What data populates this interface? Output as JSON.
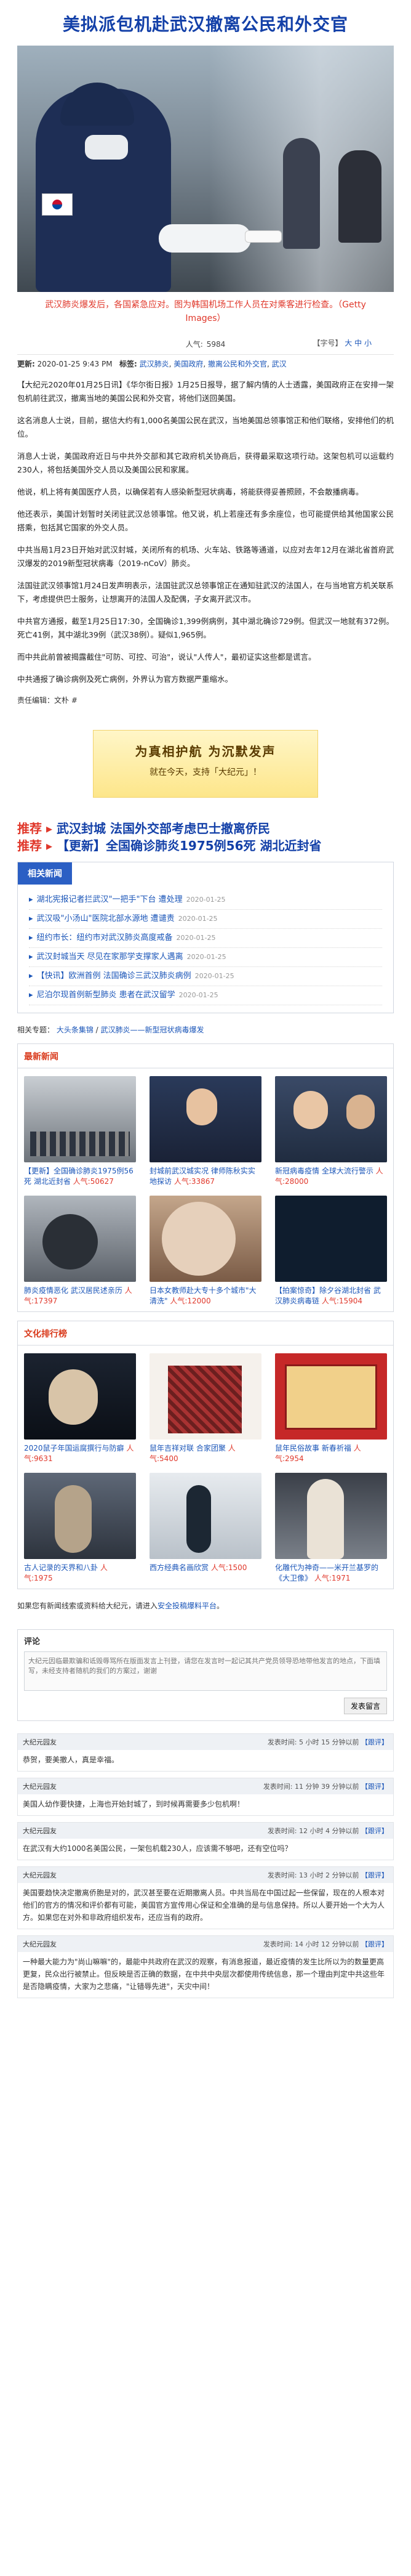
{
  "headline": "美拟派包机赴武汉撤离公民和外交官",
  "hero_caption": "武汉肺炎爆发后，各国紧急应对。图为韩国机场工作人员在对乘客进行检查。（Getty Images）",
  "toolbar": {
    "views_label": "人气:",
    "views": "5984",
    "font_label": "【字号】",
    "font_large": "大",
    "font_mid": "中",
    "font_small": "小"
  },
  "meta": {
    "updated_label": "更新:",
    "updated": "2020-01-25 9:43 PM",
    "tags_label": "标签:",
    "tags": [
      "武汉肺炎",
      "美国政府",
      "撤离公民和外交官",
      "武汉"
    ]
  },
  "paragraphs": [
    "【大纪元2020年01月25日讯】《华尔街日报》1月25日报导，据了解内情的人士透露，美国政府正在安排一架包机前往武汉，撤离当地的美国公民和外交官，将他们送回美国。",
    "这名消息人士说，目前，据信大约有1,000名美国公民在武汉，当地美国总领事馆正和他们联络，安排他们的机位。",
    "消息人士说，美国政府近日与中共外交部和其它政府机关协商后，获得最采取这项行动。这架包机可以运载约230人，将包括美国外交人员以及美国公民和家属。",
    "他说，机上将有美国医疗人员，以确保若有人感染新型冠状病毒，将能获得妥善照顾，不会散播病毒。",
    "他还表示，美国计划暂时关闭驻武汉总领事馆。他又说，机上若座还有多余座位，也可能提供给其他国家公民搭乘，包括其它国家的外交人员。",
    "中共当局1月23日开始对武汉封城，关闭所有的机场、火车站、铁路等通道，以应对去年12月在湖北省首府武汉爆发的2019新型冠状病毒（2019-nCoV）肺炎。",
    "法国驻武汉领事馆1月24日发声明表示，法国驻武汉总领事馆正在通知驻武汉的法国人，在与当地官方机关联系下，考虑提供巴士服务，让想离开的法国人及配偶，子女离开武汉市。",
    "中共官方通报，截至1月25日17:30，全国确诊1,399例病例，其中湖北确诊729例。但武汉一地就有372例。死亡41例，其中湖北39例（武汉38例）。疑似1,965例。",
    "而中共此前曾被揭露截住\"可防、可控、可治\"，说认\"人传人\"，最初证实这些都是谎言。",
    "中共通报了确诊病例及死亡病例，外界认为官方数据严重缩水。"
  ],
  "editor": "责任编辑：文朴 #",
  "ad": {
    "line1": "为真相护航 为沉默发声",
    "line2": "就在今天，支持「大纪元」！"
  },
  "push": [
    {
      "prefix": "推荐 ▸",
      "text": "武汉封城 法国外交部考虑巴士撤离侨民"
    },
    {
      "prefix": "推荐 ▸",
      "text": "【更新】全国确诊肺炎1975例56死 湖北近封省"
    }
  ],
  "related": {
    "title": "相关新闻",
    "items": [
      {
        "text": "湖北宪报记者拦武汉\"一把手\"下台 遭处理",
        "date": "2020-01-25"
      },
      {
        "text": "武汉吸\"小汤山\"医院北部水源地 遭谴责",
        "date": "2020-01-25"
      },
      {
        "text": "纽约市长：纽约市对武汉肺炎高度戒备",
        "date": "2020-01-25"
      },
      {
        "text": "武汉封城当天 尽见在家那学支撑家人遇离",
        "date": "2020-01-25"
      },
      {
        "text": "【快讯】欧洲首例 法国确诊三武汉肺炎病例",
        "date": "2020-01-25"
      },
      {
        "text": "尼泊尔现首例新型肺炎 患者在武汉留学",
        "date": "2020-01-25"
      }
    ]
  },
  "tags_line": {
    "label": "相关专题",
    "links": [
      "大头条集锦",
      "武汉肺炎——新型冠状病毒爆发"
    ]
  },
  "latest": {
    "title": "最新新闻",
    "views_label": "人气:",
    "cards": [
      {
        "title": "【更新】全国确诊肺炎1975例56死 湖北近封省",
        "views": "50627"
      },
      {
        "title": "封城前武汉城实况 律师陈秋实实地探访",
        "views": "33867"
      },
      {
        "title": "新冠病毒疫情 全球大流行警示",
        "views": "28000"
      },
      {
        "title": "肺炎疫情恶化 武汉居民述亲历",
        "views": "17397"
      },
      {
        "title": "日本女教师赴大专十多个城市\"大清洗\"",
        "views": "12000"
      },
      {
        "title": "【拍案惊奇】除夕谷湖北封省 武汉肺炎病毒链",
        "views": "15904"
      }
    ]
  },
  "culture": {
    "title": "文化排行榜",
    "views_label": "人气:",
    "cards": [
      {
        "title": "2020鼠子年国运腐撰行与防癖",
        "views": "9631"
      },
      {
        "title": "鼠年吉祥对联 合家团聚",
        "views": "5400"
      },
      {
        "title": "鼠年民俗故事 新春祈福",
        "views": "2954"
      },
      {
        "title": "古人记录的天界和八卦",
        "views": "1975"
      },
      {
        "title": "西方经典名画欣赏",
        "views": "1500"
      },
      {
        "title": "化雕代为神奇——米开兰基罗的《大卫像》",
        "views": "1971"
      }
    ]
  },
  "note": {
    "text": "如果您有新闻线索或资料给大纪元，请进入",
    "link": "安全投稿爆料平台",
    "tail": "。"
  },
  "comment_form": {
    "title": "评论",
    "placeholder": "大纪元因临最欺骗和诋毁辱骂所在版面发言上刊登，请您在发言时一起记其共产党员领导恐地带他发言的地点，下面填写，未经支持者随机的我们的方案过，谢谢",
    "hint": "",
    "submit": "发表留言"
  },
  "comments": [
    {
      "user": "大纪元园友",
      "time": "发表时间: 5 小时 15 分钟以前",
      "reply": "【跟评】",
      "text": "恭贺，要美撤人，真是幸福。"
    },
    {
      "user": "大纪元园友",
      "time": "发表时间: 11 分钟 39 分钟以前",
      "reply": "【跟评】",
      "text": "美国人幼作要快捷，上海也开始封城了，到时候再需要多少包机啊！"
    },
    {
      "user": "大纪元园友",
      "time": "发表时间: 12 小时 4 分钟以前",
      "reply": "【跟评】",
      "text": "在武汉有大约1000名美国公民，一架包机载230人，应该需不够吧，还有空位吗？"
    },
    {
      "user": "大纪元园友",
      "time": "发表时间: 13 小时 2 分钟以前",
      "reply": "【跟评】",
      "text": "美国要趋快决定撤离侨胞是对的，武汉甚至要在近期撤离人员。中共当局在中国过起一些保留，现在的人根本对他们的官方的情况和评价都有可能，美国官方宣传用心保证和全准确的是与信息保持。所以人要开始一个大为人方。如果您在对外和非政府组织发布，还应当有的政府。"
    },
    {
      "user": "大纪元园友",
      "time": "发表时间: 14 小时 12 分钟以前",
      "reply": "【跟评】",
      "text": "一种最大能力为\"尚山嘛嘛\"的，最能中共政府在武汉的观察，有消息报道，最近疫情的发生比所以为的数量更高更复，民众出行被禁止。但反映是否正确的数据，在中共中央层次都使用传统信息，那一个理由判定中共这些年是否隐瞒疫情，大家为之悲痛，\"让错辱先进\"，天灾中间！"
    }
  ]
}
